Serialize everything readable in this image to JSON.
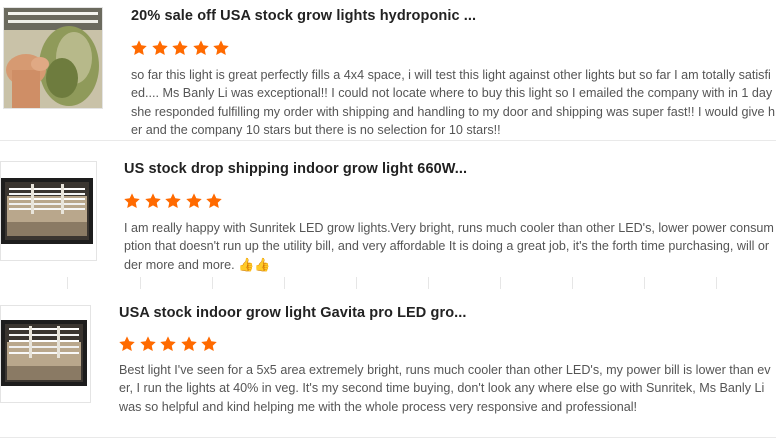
{
  "reviews": [
    {
      "title": "20% sale off USA stock grow lights hydroponic ...",
      "rating": 5,
      "text": "so far this light is great perfectly fills a 4x4 space, i will test this light against other lights but so far I am totally satisfied.... Ms Banly Li was exceptional!! I could not locate where to buy this light so I emailed the company with in 1 day she responded fulfilling my order with shipping and handling to my door and shipping was super fast!! I would give her and the company 10 stars but there is no selection for 10 stars!!",
      "emoji": "",
      "image": "hand-holding-plant-photo"
    },
    {
      "title": "US stock drop shipping indoor grow light 660W...",
      "rating": 5,
      "text": "I am really happy with Sunritek LED grow lights.Very bright, runs much cooler than other LED's, lower power consumption that doesn't run up the utility bill, and very affordable It is doing a great job, it's the forth time purchasing, will order more and more. ",
      "emoji": "👍👍",
      "image": "grow-tent-photo"
    },
    {
      "title": "USA stock indoor grow light Gavita pro LED gro...",
      "rating": 5,
      "text": "Best light I've seen for a 5x5 area extremely bright, runs much cooler than other LED's, my power bill is lower than ever, I run the lights at 40% in veg. It's my second time buying, don't look any where else go with Sunritek, Ms Banly Li was so helpful and kind helping me with the whole process very responsive and professional!",
      "emoji": "",
      "image": "grow-tent-photo"
    }
  ],
  "colors": {
    "star": "#ff6a00",
    "title": "#222222",
    "text": "#555555"
  }
}
